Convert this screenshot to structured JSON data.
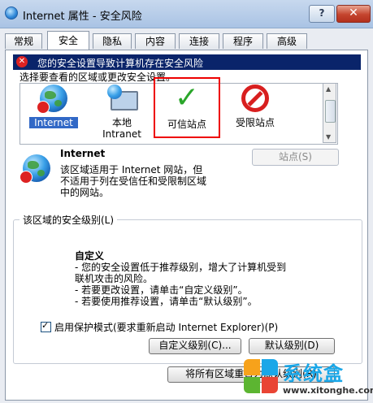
{
  "window": {
    "title": "Internet 属性 - 安全风险",
    "help_label": "?",
    "close_label": "✕"
  },
  "tabs": [
    {
      "label": "常规"
    },
    {
      "label": "安全",
      "active": true
    },
    {
      "label": "隐私"
    },
    {
      "label": "内容"
    },
    {
      "label": "连接"
    },
    {
      "label": "程序"
    },
    {
      "label": "高级"
    }
  ],
  "warning": {
    "text": "您的安全设置导致计算机存在安全风险"
  },
  "zone_hint": "选择要查看的区域或更改安全设置。",
  "zones": [
    {
      "label": "Internet",
      "selected": true,
      "icon": "internet-globe-icon"
    },
    {
      "label_line1": "本地",
      "label_line2": "Intranet",
      "icon": "local-intranet-icon"
    },
    {
      "label": "可信站点",
      "icon": "trusted-sites-check-icon"
    },
    {
      "label": "受限站点",
      "icon": "restricted-sites-no-entry-icon"
    }
  ],
  "zone_info": {
    "title": "Internet",
    "desc_line1": "该区域适用于 Internet 网站，但",
    "desc_line2": "不适用于列在受信任和受限制区域",
    "desc_line3": "中的网站。",
    "sites_button": "站点(S)"
  },
  "security_level": {
    "group_title": "该区域的安全级别(L)",
    "level_title": "自定义",
    "line1": "- 您的安全设置低于推荐级别，增大了计算机受到",
    "line2": "联机攻击的风险。",
    "line3": "- 若要更改设置，请单击“自定义级别”。",
    "line4": "- 若要使用推荐设置，请单击“默认级别”。",
    "protected_mode_label": "启用保护模式(要求重新启动 Internet Explorer)(P)",
    "protected_mode_checked": true,
    "custom_level_button": "自定义级别(C)...",
    "default_level_button": "默认级别(D)",
    "reset_all_button": "将所有区域重置为默认级别(R)"
  },
  "watermark": {
    "brand": "系统盒",
    "url": "www.xitonghe.com"
  },
  "colors": {
    "warning_bg": "#0a246a",
    "highlight_box": "#ee0000",
    "selected_zone": "#3168c6",
    "check_green": "#2aa62a",
    "no_entry_red": "#d81f1f"
  }
}
